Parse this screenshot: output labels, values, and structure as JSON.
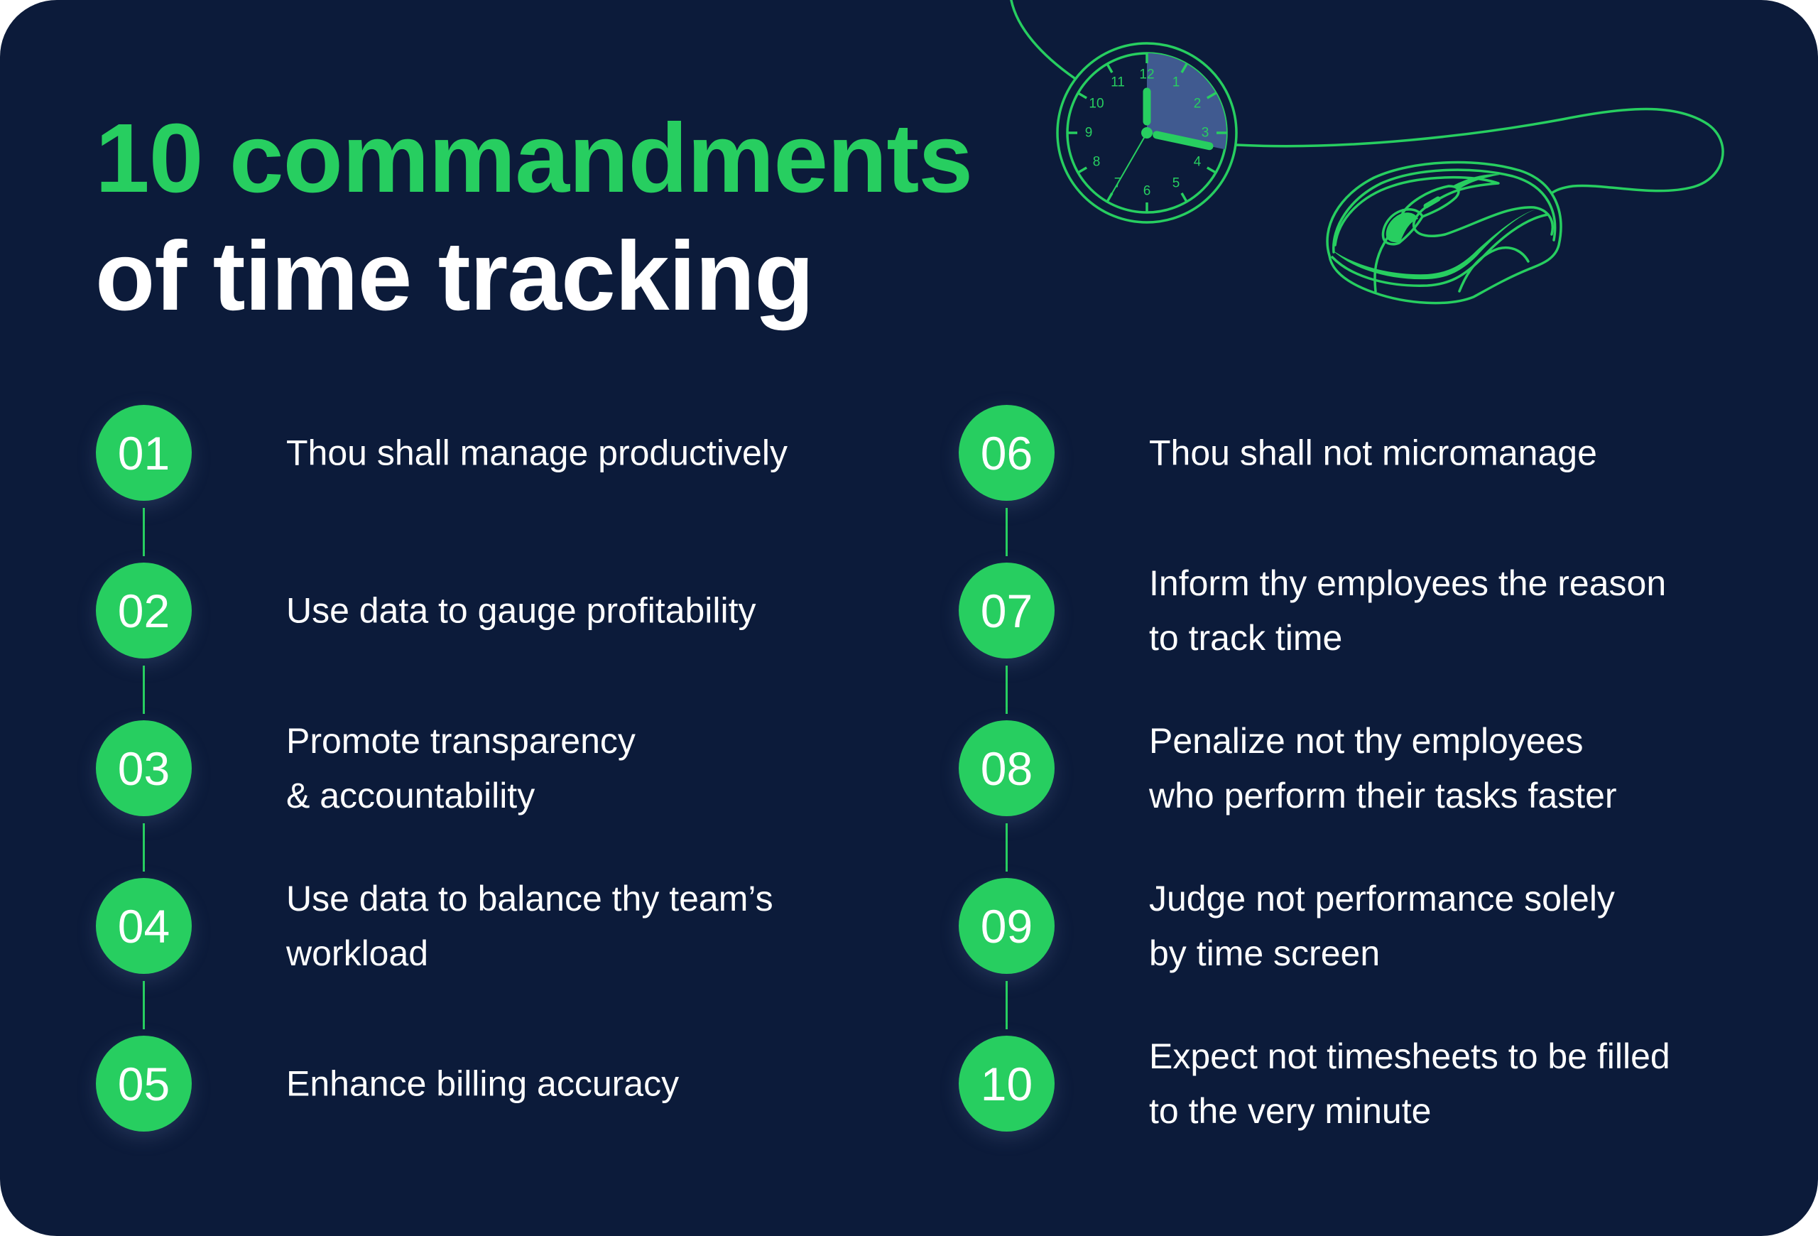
{
  "title": {
    "line1": "10 commandments",
    "line2": "of time tracking"
  },
  "illustration": {
    "clock": {
      "numerals": [
        "12",
        "1",
        "2",
        "3",
        "4",
        "5",
        "6",
        "7",
        "8",
        "9",
        "10",
        "11"
      ],
      "shaded_minutes": 17,
      "hour_hand_hour": 12,
      "minute_hand_minute": 17,
      "second_hand_second": 35
    },
    "mouse": "computer-mouse-icon"
  },
  "colors": {
    "background": "#0c1b3a",
    "accent": "#27ce60",
    "text": "#ffffff",
    "clock_shade": "#405a90"
  },
  "commandments": [
    {
      "number": "01",
      "text": "Thou shall manage productively"
    },
    {
      "number": "02",
      "text": "Use data to gauge profitability"
    },
    {
      "number": "03",
      "text": "Promote transparency\n& accountability"
    },
    {
      "number": "04",
      "text": "Use data to balance thy team’s\nworkload"
    },
    {
      "number": "05",
      "text": "Enhance billing accuracy"
    },
    {
      "number": "06",
      "text": "Thou shall not micromanage"
    },
    {
      "number": "07",
      "text": "Inform thy employees the reason\nto track time"
    },
    {
      "number": "08",
      "text": "Penalize not thy employees\nwho perform their tasks faster"
    },
    {
      "number": "09",
      "text": "Judge not performance solely\nby time screen"
    },
    {
      "number": "10",
      "text": "Expect not timesheets to be filled\nto the very minute"
    }
  ]
}
